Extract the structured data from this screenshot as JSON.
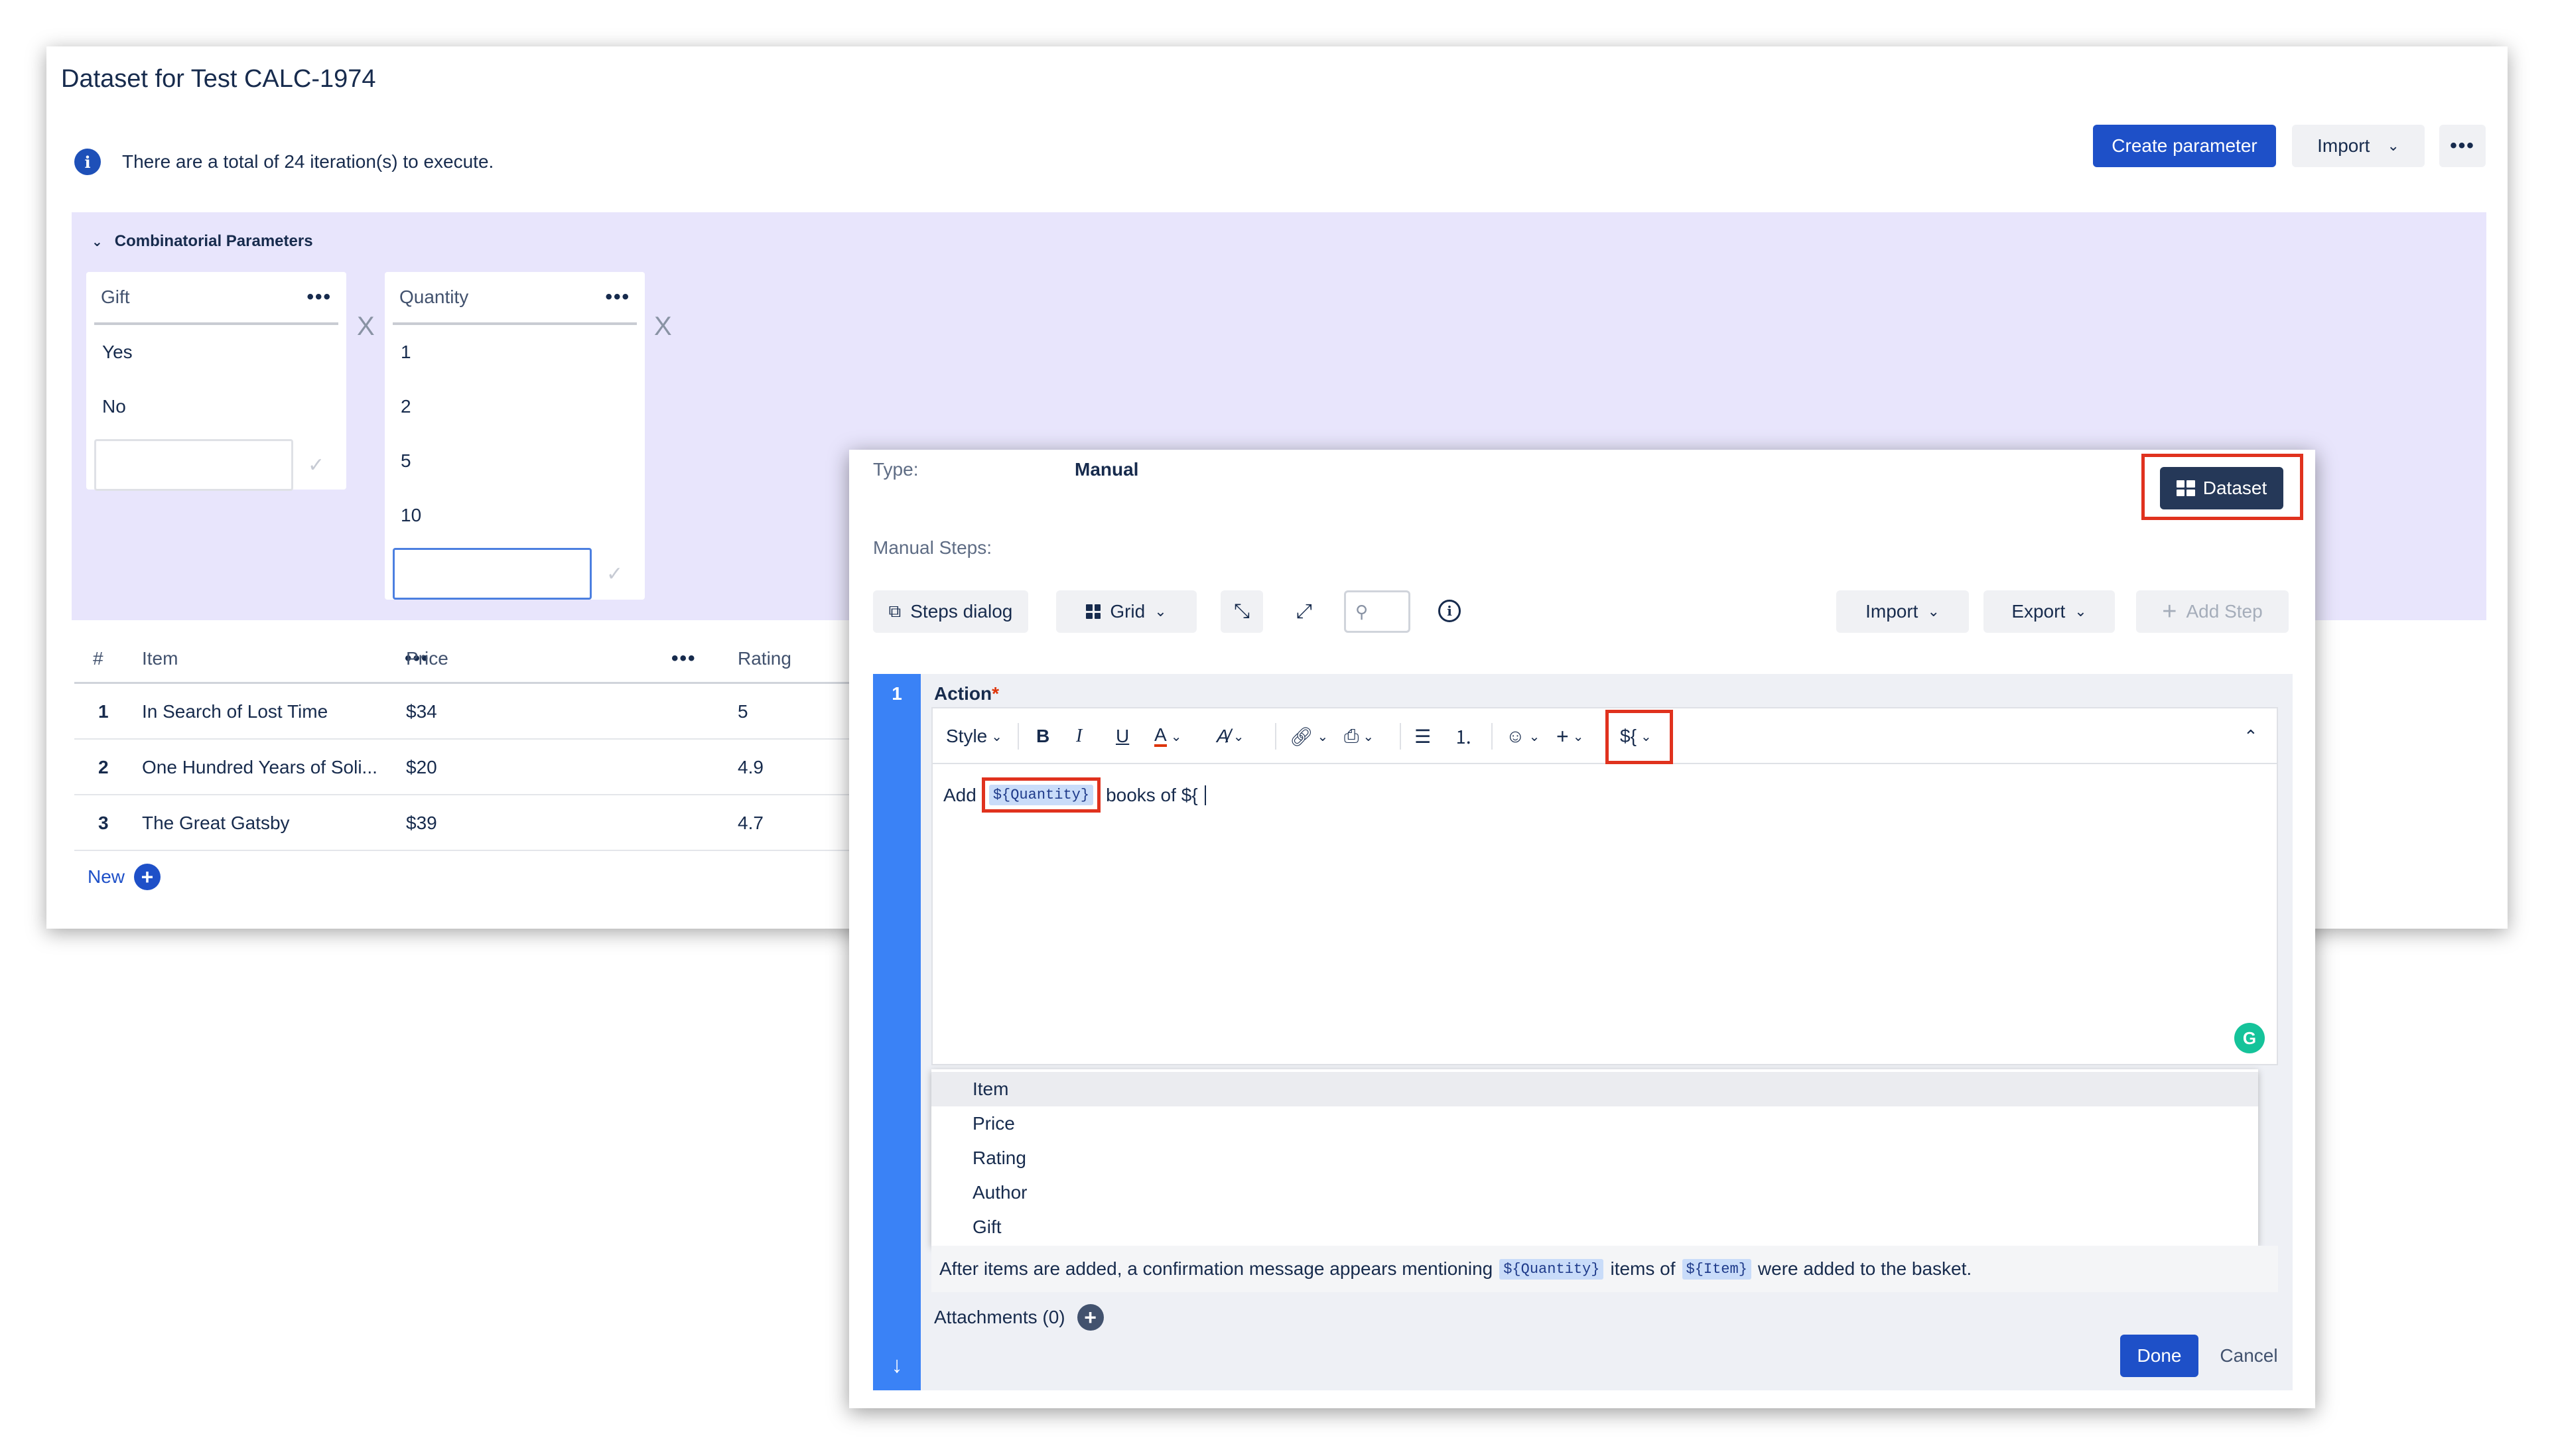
{
  "dataset": {
    "title": "Dataset for Test CALC-1974",
    "info_icon": "info-icon",
    "info_text": "There are a total of 24 iteration(s) to execute.",
    "create_parameter_label": "Create parameter",
    "import_label": "Import",
    "more_label": "•••",
    "combinatorial_title": "Combinatorial Parameters",
    "separator": "X",
    "params": [
      {
        "name": "Gift",
        "values": [
          "Yes",
          "No"
        ]
      },
      {
        "name": "Quantity",
        "values": [
          "1",
          "2",
          "5",
          "10"
        ]
      }
    ],
    "param_menu": "•••",
    "table": {
      "headers": {
        "num": "#",
        "item": "Item",
        "price": "Price",
        "rating": "Rating"
      },
      "rows": [
        {
          "num": "1",
          "item": "In Search of Lost Time",
          "price": "$34",
          "rating": "5"
        },
        {
          "num": "2",
          "item": "One Hundred Years of Soli...",
          "price": "$20",
          "rating": "4.9"
        },
        {
          "num": "3",
          "item": "The Great Gatsby",
          "price": "$39",
          "rating": "4.7"
        }
      ]
    },
    "new_label": "New"
  },
  "dialog": {
    "type_label": "Type:",
    "type_value": "Manual",
    "dataset_button": "Dataset",
    "manual_steps_label": "Manual Steps:",
    "toolbar": {
      "steps_dialog": "Steps dialog",
      "grid": "Grid",
      "import": "Import",
      "export": "Export",
      "add_step": "Add Step"
    },
    "step": {
      "number": "1",
      "action_label": "Action",
      "required_mark": "*",
      "editor_toolbar": {
        "style": "Style",
        "bold": "B",
        "italic": "I",
        "underline": "U",
        "text_color": "A",
        "variable": "${"
      },
      "body": {
        "prefix": "Add",
        "chip": "${Quantity}",
        "middle": "books of $",
        "typed": "{"
      },
      "dropdown_items": [
        "Item",
        "Price",
        "Rating",
        "Author",
        "Gift"
      ],
      "expected": {
        "part1": "After items are added, a confirmation message appears mentioning",
        "chip1": "${Quantity}",
        "part2": "items of",
        "chip2": "${Item}",
        "part3": "were added to the basket."
      },
      "attachments_label": "Attachments (0)"
    },
    "done_label": "Done",
    "cancel_label": "Cancel"
  },
  "colors": {
    "primary": "#1e50c8",
    "panel": "#e8e5fc",
    "step_bar": "#3a82f6",
    "highlight": "#e0321e",
    "dataset_button": "#253858"
  }
}
